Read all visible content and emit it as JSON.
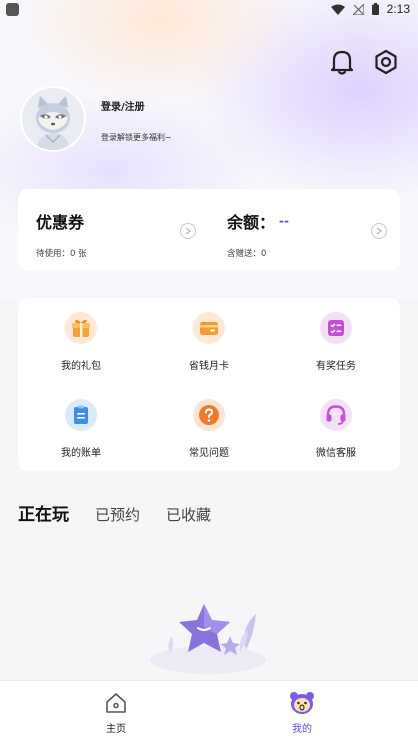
{
  "status_bar": {
    "time": "2:13"
  },
  "profile": {
    "login_label": "登录/注册",
    "login_hint": "登录解锁更多福利~"
  },
  "wallet": {
    "coupon_title": "优惠券",
    "coupon_sub": "待使用：0 张",
    "balance_title": "余额：",
    "balance_value": "--",
    "balance_sub": "含赠送：0"
  },
  "grid": {
    "items": [
      {
        "label": "我的礼包",
        "icon": "gift-icon"
      },
      {
        "label": "省钱月卡",
        "icon": "card-icon"
      },
      {
        "label": "有奖任务",
        "icon": "task-icon"
      },
      {
        "label": "我的账单",
        "icon": "bill-icon"
      },
      {
        "label": "常见问题",
        "icon": "question-icon"
      },
      {
        "label": "微信客服",
        "icon": "headset-icon"
      }
    ]
  },
  "tabs": [
    "正在玩",
    "已预约",
    "已收藏"
  ],
  "bottom_nav": {
    "items": [
      {
        "label": "主页",
        "icon": "home-icon"
      },
      {
        "label": "我的",
        "icon": "bear-icon"
      }
    ]
  },
  "colors": {
    "accent": "#6a4bd6",
    "balance_dash": "#4b53c9"
  }
}
